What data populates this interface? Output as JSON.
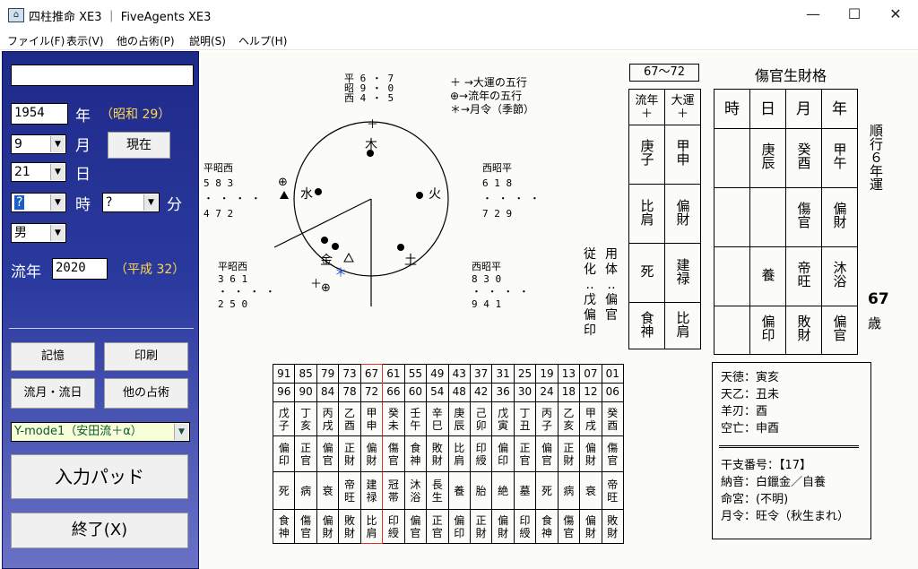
{
  "window": {
    "title": "四柱推命 XE3 ｜ FiveAgents XE3",
    "icon": "pillar-icon",
    "controls": [
      "—",
      "☐",
      "✕"
    ]
  },
  "menu": [
    "ファイル(F)",
    "表示(V)",
    "他の占術(P)",
    "説明(S)",
    "ヘルプ(H)"
  ],
  "left": {
    "name_value": "",
    "year_value": "1954",
    "year_label": "年",
    "era": "（昭和 29）",
    "month_value": "9",
    "month_label": "月",
    "now_button": "現在",
    "day_value": "21",
    "day_label": "日",
    "hour_value": "?",
    "hour_label": "時",
    "minute_value": "?",
    "minute_label": "分",
    "gender_value": "男",
    "flow_year_label": "流年",
    "flow_year_value": "2020",
    "flow_era": "（平成 32）",
    "buttons": {
      "memory": "記憶",
      "print": "印刷",
      "flow_month_day": "流月・流日",
      "other": "他の占術",
      "mode": "Y-mode1（安田流＋α）",
      "input_pad": "入力パッド",
      "exit": "終了(X)"
    }
  },
  "diagram": {
    "top_numbers": {
      "r1": "平 6 ・ 7",
      "r2": "昭 9 ・ 0",
      "r3": "西 4 ・ 5"
    },
    "legend": [
      "＋ →大運の五行",
      "⊕→流年の五行",
      "＊→月令（季節）"
    ],
    "elements": [
      "木",
      "火",
      "土",
      "金",
      "水"
    ],
    "left_upper": {
      "head": "平昭西",
      "r1": "5 8 3",
      "r2": "・ ・ ・ ・",
      "r3": "4 7 2"
    },
    "right_upper": {
      "head": "西昭平",
      "r1": "6 1 8",
      "r2": "・ ・ ・ ・",
      "r3": "7 2 9"
    },
    "left_lower": {
      "head": "平昭西",
      "r1": "3 6 1",
      "r2": "・ ・ ・ ・",
      "r3": "2 5 0"
    },
    "right_lower": {
      "head": "西昭平",
      "r1": "8 3 0",
      "r2": "・ ・ ・ ・",
      "r3": "9 4 1"
    }
  },
  "period_box": "67〜72",
  "flow_table": {
    "headers": [
      [
        "流年",
        "＋"
      ],
      [
        "大運",
        "＋"
      ]
    ],
    "rows": [
      [
        "庚子",
        "甲申"
      ],
      [
        "比肩",
        "偏財"
      ],
      [
        "死",
        "建禄"
      ],
      [
        "食神",
        "比肩"
      ]
    ]
  },
  "side_labels": {
    "col1": [
      "従",
      "化",
      "‥",
      "戊",
      "偏",
      "印"
    ],
    "col2": [
      "用",
      "体",
      "‥",
      "偏",
      "官"
    ]
  },
  "pattern_title": "傷官生財格",
  "pillar_table": {
    "headers": [
      "時",
      "日",
      "月",
      "年"
    ],
    "rows": [
      [
        "",
        "庚辰",
        "癸酉",
        "甲午"
      ],
      [
        "",
        "",
        "傷官",
        "偏財"
      ],
      [
        "",
        "養",
        "帝旺",
        "沐浴"
      ],
      [
        "",
        "偏印",
        "敗財",
        "偏官"
      ]
    ]
  },
  "right_vertical": "順行６年運",
  "age": {
    "value": "67",
    "unit": "歳"
  },
  "luck_table": {
    "ages": [
      [
        "91",
        "96"
      ],
      [
        "85",
        "90"
      ],
      [
        "79",
        "84"
      ],
      [
        "73",
        "78"
      ],
      [
        "67",
        "72"
      ],
      [
        "61",
        "66"
      ],
      [
        "55",
        "60"
      ],
      [
        "49",
        "54"
      ],
      [
        "43",
        "48"
      ],
      [
        "37",
        "42"
      ],
      [
        "31",
        "36"
      ],
      [
        "25",
        "30"
      ],
      [
        "19",
        "24"
      ],
      [
        "13",
        "18"
      ],
      [
        "07",
        "12"
      ],
      [
        "01",
        "06"
      ]
    ],
    "ganzhi": [
      "戊子",
      "丁亥",
      "丙戌",
      "乙酉",
      "甲申",
      "癸未",
      "壬午",
      "辛巳",
      "庚辰",
      "己卯",
      "戊寅",
      "丁丑",
      "丙子",
      "乙亥",
      "甲戌",
      "癸酉"
    ],
    "stars": [
      "偏印",
      "正官",
      "偏官",
      "正財",
      "偏財",
      "傷官",
      "食神",
      "敗財",
      "比肩",
      "印綬",
      "偏印",
      "正官",
      "偏官",
      "正財",
      "偏財",
      "傷官"
    ],
    "fortune12": [
      "死",
      "病",
      "衰",
      "帝旺",
      "建禄",
      "冠帯",
      "沐浴",
      "長生",
      "養",
      "胎",
      "絶",
      "墓",
      "死",
      "病",
      "衰",
      "帝旺"
    ],
    "branch_stars": [
      "食神",
      "傷官",
      "偏財",
      "敗財",
      "比肩",
      "印綬",
      "偏官",
      "正官",
      "偏印",
      "正財",
      "偏財",
      "印綬",
      "食神",
      "傷官",
      "偏財",
      "敗財"
    ],
    "highlight_index": 4
  },
  "info_box": {
    "line1": "天徳：寅亥",
    "line2": "天乙：丑未",
    "line3": "羊刃：酉",
    "line4": "空亡：申酉",
    "line5": "干支番号：【17】",
    "line6": "納音：白鑞金／自養",
    "line7": "命宮：(不明)",
    "line8": "月令：旺令（秋生まれ）"
  }
}
